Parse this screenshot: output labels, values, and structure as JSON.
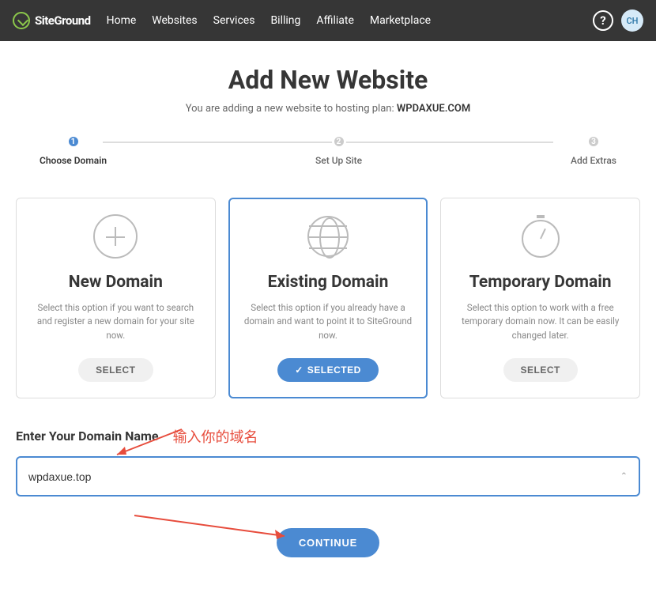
{
  "logo_text": "SiteGround",
  "nav": {
    "home": "Home",
    "websites": "Websites",
    "services": "Services",
    "billing": "Billing",
    "affiliate": "Affiliate",
    "marketplace": "Marketplace"
  },
  "help_glyph": "?",
  "avatar_initials": "CH",
  "title": "Add New Website",
  "subtitle_prefix": "You are adding a new website to hosting plan: ",
  "subtitle_plan": "WPDAXUE.COM",
  "steps": [
    {
      "num": "1",
      "label": "Choose Domain"
    },
    {
      "num": "2",
      "label": "Set Up Site"
    },
    {
      "num": "3",
      "label": "Add Extras"
    }
  ],
  "cards": {
    "new": {
      "title": "New Domain",
      "desc": "Select this option if you want to search and register a new domain for your site now.",
      "btn": "SELECT"
    },
    "existing": {
      "title": "Existing Domain",
      "desc": "Select this option if you already have a domain and want to point it to SiteGround now.",
      "btn": "SELECTED",
      "check": "✓"
    },
    "temp": {
      "title": "Temporary Domain",
      "desc": "Select this option to work with a free temporary domain now. It can be easily changed later.",
      "btn": "SELECT"
    }
  },
  "domain_section_label": "Enter Your Domain Name",
  "annotation_text": "输入你的域名",
  "domain_value": "wpdaxue.top",
  "caret_glyph": "⌃",
  "continue_label": "CONTINUE"
}
